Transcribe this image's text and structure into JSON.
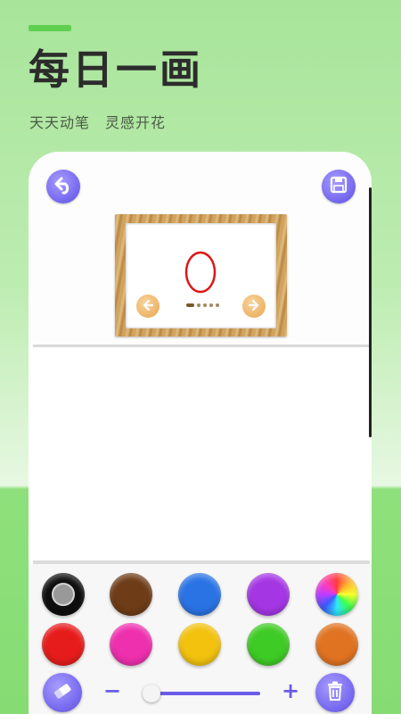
{
  "header": {
    "title": "每日一画",
    "subtitle": "天天动笔　灵感开花"
  },
  "toolbar": {
    "back_icon": "undo-arrow-icon",
    "save_icon": "save-disk-icon"
  },
  "preview": {
    "page_count": 5,
    "active_page": 1,
    "prev_icon": "arrow-left-icon",
    "next_icon": "arrow-right-icon"
  },
  "palette": {
    "colors": [
      {
        "name": "black",
        "hex": "#0e0e0e",
        "selected": true
      },
      {
        "name": "brown",
        "hex": "#6e3c17"
      },
      {
        "name": "blue",
        "hex": "#2a73e5"
      },
      {
        "name": "purple",
        "hex": "#a436e4"
      },
      {
        "name": "custom-color",
        "hex": "rainbow"
      },
      {
        "name": "red",
        "hex": "#e61c1c"
      },
      {
        "name": "pink",
        "hex": "#ee2fae"
      },
      {
        "name": "yellow",
        "hex": "#f2c20f"
      },
      {
        "name": "green",
        "hex": "#3fcb25"
      },
      {
        "name": "orange",
        "hex": "#e07321"
      }
    ]
  },
  "brush": {
    "minus_label": "−",
    "plus_label": "+",
    "size_fraction": 0.05,
    "eraser_icon": "eraser-icon",
    "trash_icon": "trash-icon"
  },
  "colors": {
    "accent": "#7b6df0",
    "background_green": "#a8e59a",
    "title_bar": "#5fcf52"
  }
}
